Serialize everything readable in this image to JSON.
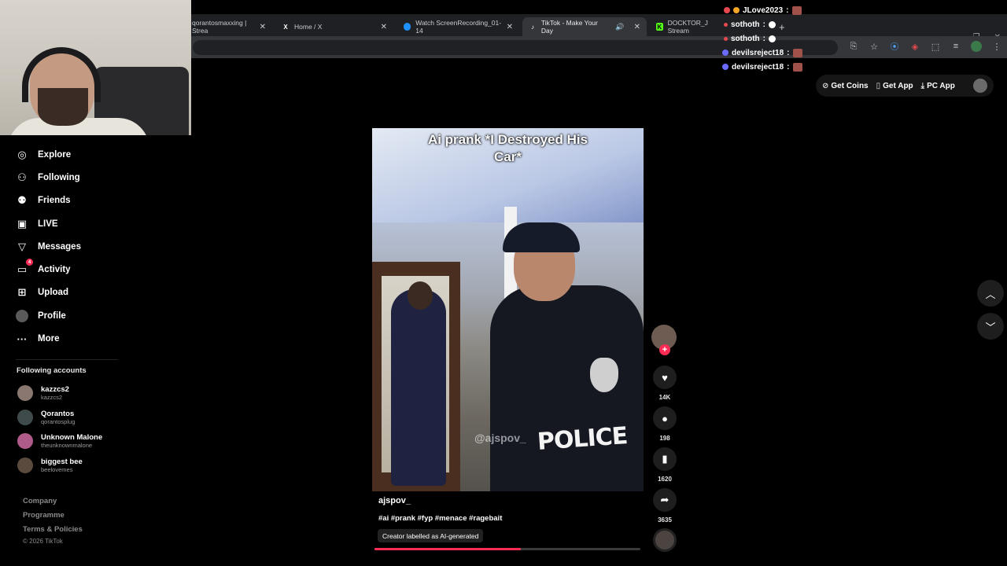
{
  "browser": {
    "tabs": [
      {
        "label": "qorantosmaxxing | Strea",
        "icon": "twitch-icon",
        "color": "#9146ff"
      },
      {
        "label": "Home / X",
        "icon": "x-icon",
        "glyph": "X"
      },
      {
        "label": "Watch ScreenRecording_01-14",
        "icon": "streamable-icon",
        "color": "#1e90ff"
      },
      {
        "label": "TikTok - Make Your Day",
        "icon": "tiktok-icon",
        "active": true
      },
      {
        "label": "DOCKTOR_J Stream",
        "icon": "kick-icon",
        "color": "#53fc18"
      }
    ],
    "new_tab": "+"
  },
  "chat": {
    "messages": [
      {
        "user": "JLove2023",
        "text": ":",
        "badge_color": "#e5484d"
      },
      {
        "user": "sothoth",
        "text": ":",
        "badge_color": "#e5484d"
      },
      {
        "user": "sothoth",
        "text": ":",
        "badge_color": "#e5484d"
      },
      {
        "user": "devilsreject18",
        "text": ":",
        "badge_color": "#6b6bff"
      },
      {
        "user": "devilsreject18",
        "text": ":",
        "badge_color": "#6b6bff"
      }
    ]
  },
  "header": {
    "get_coins": "Get Coins",
    "get_app": "Get App",
    "pc_app": "PC App"
  },
  "sidebar": {
    "items": [
      {
        "label": "Explore",
        "icon": "compass-icon",
        "glyph": "◎"
      },
      {
        "label": "Following",
        "icon": "following-icon",
        "glyph": "⚇"
      },
      {
        "label": "Friends",
        "icon": "friends-icon",
        "glyph": "⚉"
      },
      {
        "label": "LIVE",
        "icon": "live-icon",
        "glyph": "▣"
      },
      {
        "label": "Messages",
        "icon": "messages-icon",
        "glyph": "▽"
      },
      {
        "label": "Activity",
        "icon": "activity-icon",
        "glyph": "▭",
        "badge": "4"
      },
      {
        "label": "Upload",
        "icon": "upload-icon",
        "glyph": "⊞"
      },
      {
        "label": "Profile",
        "icon": "profile-avatar"
      },
      {
        "label": "More",
        "icon": "more-icon",
        "glyph": "···"
      }
    ],
    "following_title": "Following accounts",
    "accounts": [
      {
        "name": "kazzcs2",
        "handle": "kazzcs2",
        "color": "#8a7770"
      },
      {
        "name": "Qorantos",
        "handle": "qorantosplug",
        "color": "#3f4a4a"
      },
      {
        "name": "Unknown Malone",
        "handle": "theunknownmalone",
        "color": "#b05a8a"
      },
      {
        "name": "biggest bee",
        "handle": "beelovemes",
        "color": "#5a4a3e"
      }
    ],
    "footer": [
      "Company",
      "Programme",
      "Terms & Policies"
    ],
    "copyright": "© 2026 TikTok"
  },
  "video": {
    "caption": "Ai prank *I Destroyed His Car*",
    "watermark": "@ajspov_",
    "vest_text": "POLICE",
    "author": "ajspov_",
    "tags": "#ai #prank #fyp #menace #ragebait",
    "ai_label": "Creator labelled as AI-generated",
    "progress": 0.55
  },
  "actions": {
    "likes": "14K",
    "comments": "198",
    "saves": "1620",
    "shares": "3635"
  }
}
